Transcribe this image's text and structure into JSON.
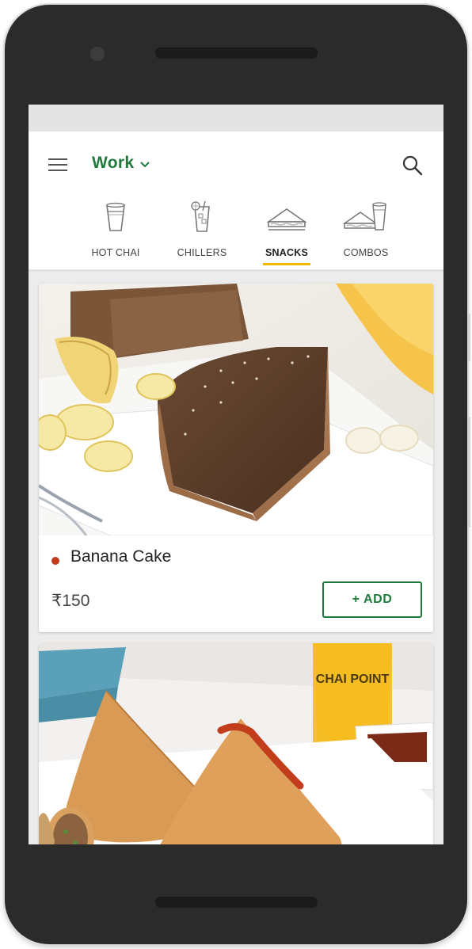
{
  "header": {
    "location_label": "Work"
  },
  "tabs": [
    {
      "label": "HOT CHAI",
      "icon": "cup-icon",
      "active": false
    },
    {
      "label": "CHILLERS",
      "icon": "iced-drink-icon",
      "active": false
    },
    {
      "label": "SNACKS",
      "icon": "sandwich-icon",
      "active": true
    },
    {
      "label": "COMBOS",
      "icon": "combo-icon",
      "active": false
    }
  ],
  "products": [
    {
      "name": "Banana Cake",
      "price": "₹150",
      "add_label": "+ ADD",
      "image": "banana-cake-photo"
    },
    {
      "image": "samosa-photo",
      "cup_brand": "CHAI POINT"
    }
  ],
  "colors": {
    "brand_green": "#1f7a3c",
    "active_tab_underline": "#f2b700",
    "non_veg_dot": "#c23b1c"
  }
}
